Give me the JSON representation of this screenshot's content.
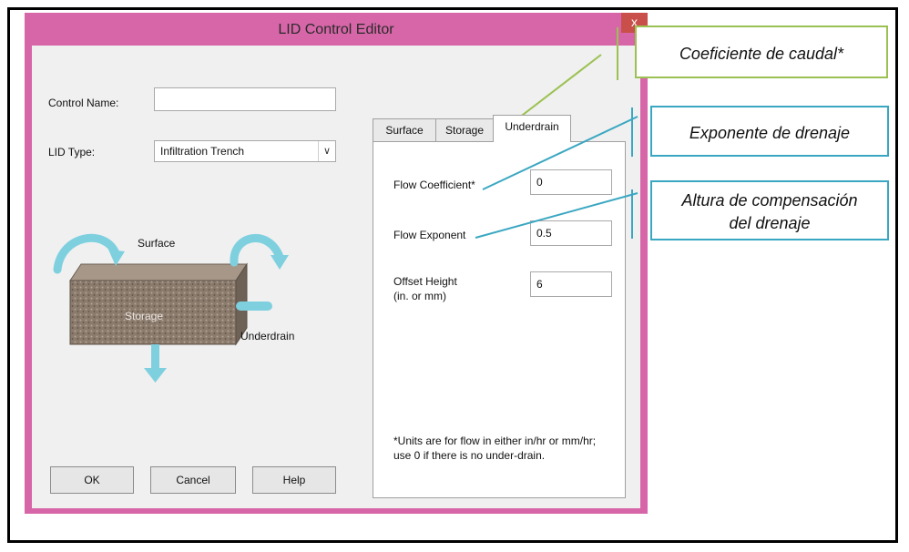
{
  "window": {
    "title": "LID Control Editor",
    "close_glyph": "x"
  },
  "form": {
    "control_name_label": "Control Name:",
    "control_name_value": "",
    "lid_type_label": "LID Type:",
    "lid_type_value": "Infiltration Trench",
    "dropdown_glyph": "∨"
  },
  "diagram": {
    "surface_label": "Surface",
    "storage_label": "Storage",
    "underdrain_label": "Underdrain"
  },
  "tabs": [
    {
      "label": "Surface"
    },
    {
      "label": "Storage"
    },
    {
      "label": "Underdrain"
    }
  ],
  "underdrain_panel": {
    "flow_coefficient_label": "Flow Coefficient*",
    "flow_coefficient_value": "0",
    "flow_exponent_label": "Flow Exponent",
    "flow_exponent_value": "0.5",
    "offset_height_label_line1": "Offset Height",
    "offset_height_label_line2": "(in. or mm)",
    "offset_height_value": "6",
    "note": "*Units are for flow in either in/hr or mm/hr; use 0 if there is no under-drain."
  },
  "buttons": {
    "ok": "OK",
    "cancel": "Cancel",
    "help": "Help"
  },
  "callouts": {
    "caudal": "Coeficiente de caudal*",
    "exponente": "Exponente de drenaje",
    "altura_line1": "Altura de compensación",
    "altura_line2": "del drenaje"
  },
  "colors": {
    "window_border": "#d666a8",
    "close_button": "#c9504a",
    "callout_green": "#9bc152",
    "callout_blue": "#3aa7c2",
    "arrow": "#7fd0df"
  }
}
